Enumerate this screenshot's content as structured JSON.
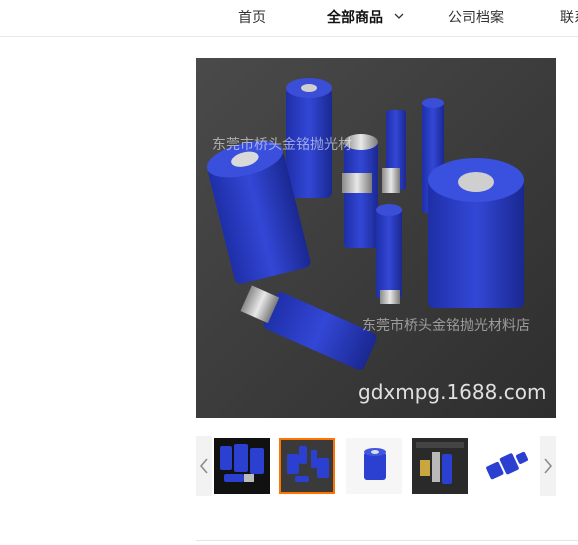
{
  "nav": {
    "home": "首页",
    "all_products": "全部商品",
    "company_profile": "公司档案",
    "contact": "联系"
  },
  "main_image": {
    "watermark_shop_top": "东莞市桥头金铭抛光材",
    "watermark_shop_bottom": "东莞市桥头金铭抛光材料店",
    "watermark_url": "gdxmpg.1688.com"
  },
  "thumbnails": {
    "selected_index": 1,
    "items": [
      {
        "label": ""
      },
      {
        "label": ""
      },
      {
        "label": ""
      },
      {
        "label": ""
      },
      {
        "label": ""
      }
    ]
  },
  "colors": {
    "accent_orange": "#ff7300",
    "roller_blue": "#2c3fc7"
  }
}
